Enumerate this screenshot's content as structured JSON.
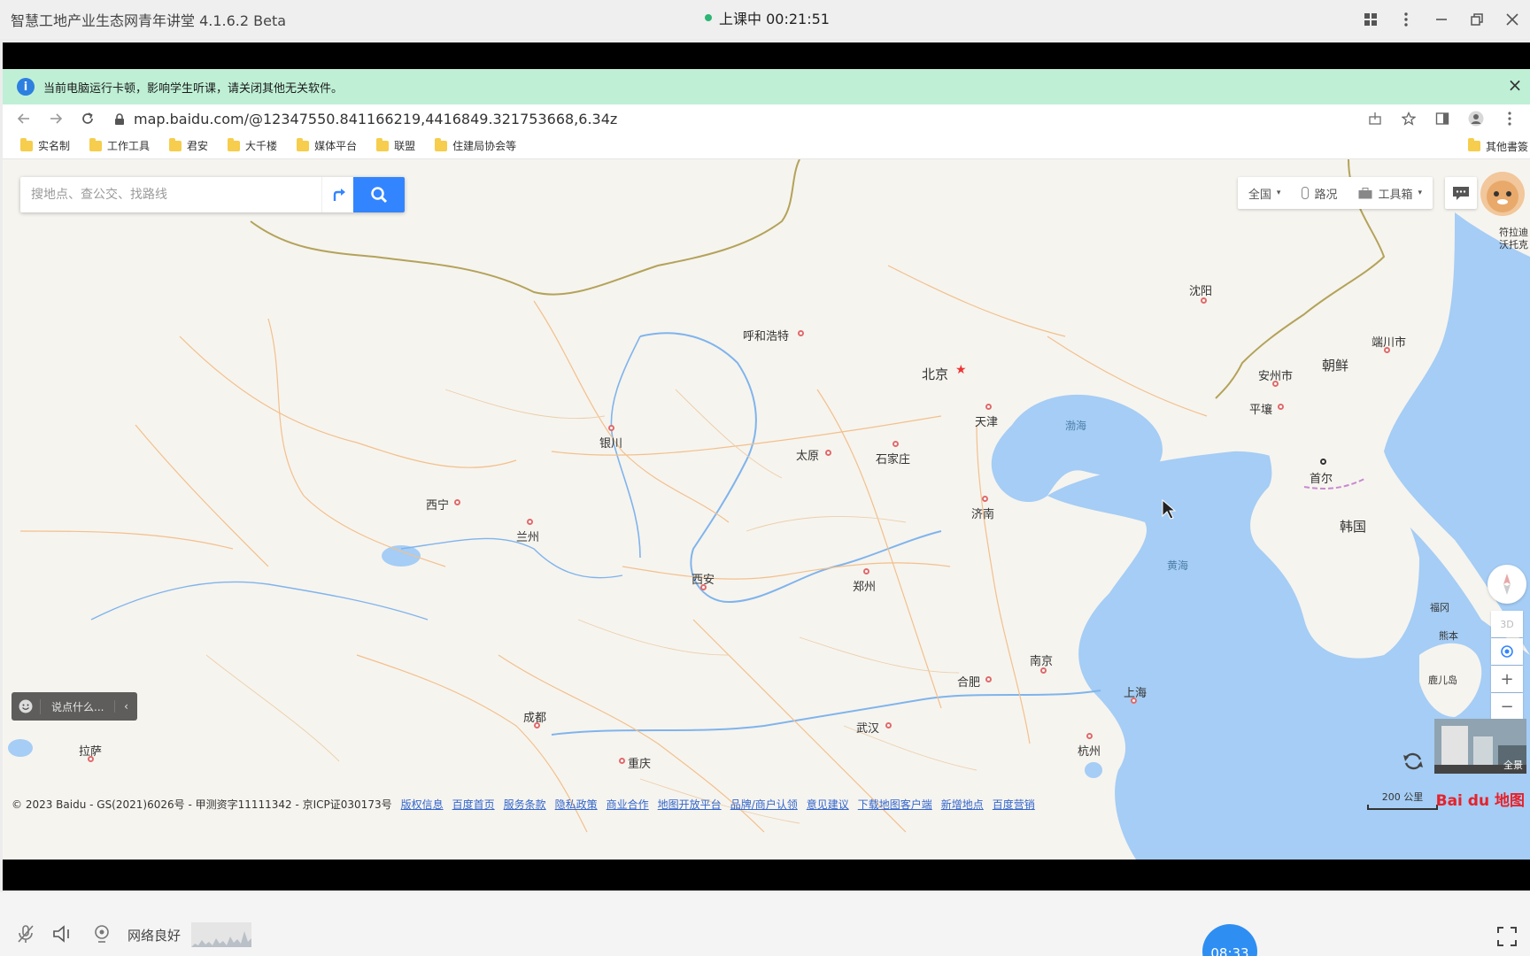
{
  "app": {
    "title": "智慧工地产业生态网青年讲堂 4.1.6.2 Beta",
    "live_status": "上课中 00:21:51"
  },
  "notice": {
    "text": "当前电脑运行卡顿，影响学生听课，请关闭其他无关软件。"
  },
  "browser": {
    "url": "map.baidu.com/@12347550.841166219,4416849.321753668,6.34z",
    "bookmarks": [
      "实名制",
      "工作工具",
      "君安",
      "大千楼",
      "媒体平台",
      "联盟",
      "住建局协会等"
    ],
    "other_bookmarks": "其他書簽"
  },
  "map": {
    "search_placeholder": "搜地点、查公交、找路线",
    "tools": {
      "region": "全国",
      "traffic": "路况",
      "toolbox": "工具箱"
    },
    "cities": [
      {
        "name": "沈阳"
      },
      {
        "name": "呼和浩特"
      },
      {
        "name": "北京"
      },
      {
        "name": "天津"
      },
      {
        "name": "安州市"
      },
      {
        "name": "平壤"
      },
      {
        "name": "端川市"
      },
      {
        "name": "银川"
      },
      {
        "name": "太原"
      },
      {
        "name": "石家庄"
      },
      {
        "name": "首尔"
      },
      {
        "name": "西宁"
      },
      {
        "name": "兰州"
      },
      {
        "name": "济南"
      },
      {
        "name": "西安"
      },
      {
        "name": "郑州"
      },
      {
        "name": "南京"
      },
      {
        "name": "合肥"
      },
      {
        "name": "上海"
      },
      {
        "name": "成都"
      },
      {
        "name": "武汉"
      },
      {
        "name": "杭州"
      },
      {
        "name": "重庆"
      },
      {
        "name": "拉萨"
      },
      {
        "name": "福冈"
      },
      {
        "name": "熊本"
      },
      {
        "name": "鹿儿岛"
      },
      {
        "name": "符拉迪沃托克"
      }
    ],
    "seas": [
      "渤海",
      "黄海"
    ],
    "countries": [
      "朝鲜",
      "韩国"
    ],
    "chat_placeholder": "说点什么...",
    "panorama_label": "全景",
    "scale": "200 公里",
    "copyright": "© 2023 Baidu - GS(2021)6026号 - 甲测资字11111342 - 京ICP证030173号",
    "footer_links": [
      "版权信息",
      "百度首页",
      "服务条款",
      "隐私政策",
      "商业合作",
      "地图开放平台",
      "品牌/商户认领",
      "意见建议",
      "下载地图客户端",
      "新增地点",
      "百度营销"
    ],
    "logo": "Bai du 地图",
    "colors": {
      "sea": "#a5cdf5",
      "land": "#f6f4ef",
      "roads": "#f0b47a",
      "search_button": "#3385ff"
    }
  },
  "bottom": {
    "network": "网络良好",
    "timer": "08:33"
  }
}
